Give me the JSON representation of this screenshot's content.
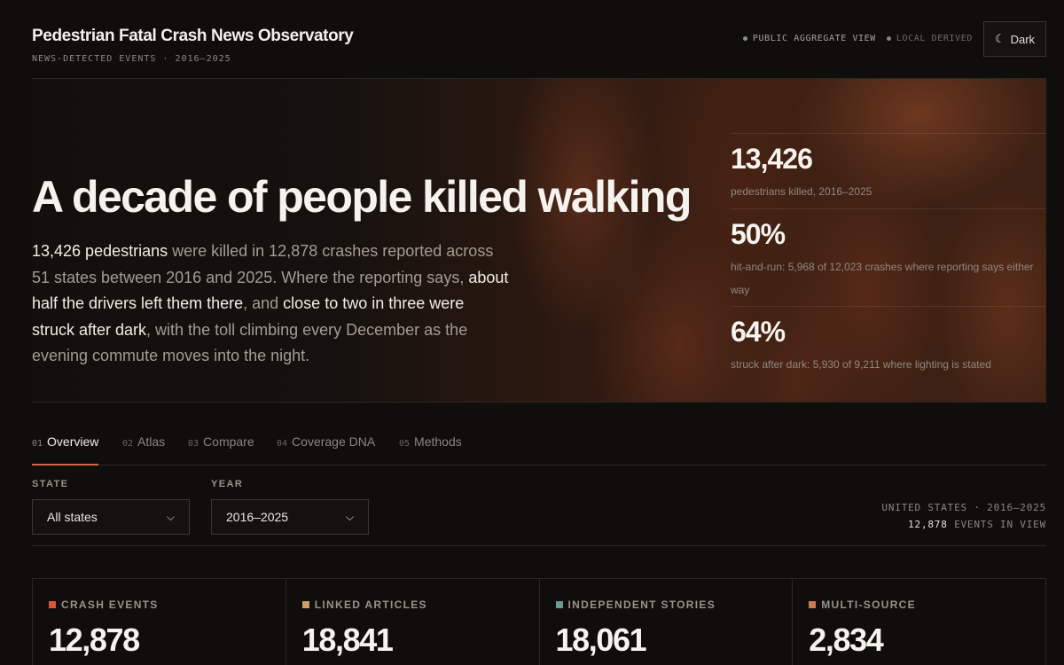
{
  "header": {
    "title": "Pedestrian Fatal Crash News Observatory",
    "subtitle": "NEWS-DETECTED EVENTS · 2016–2025",
    "status_public": "PUBLIC AGGREGATE VIEW",
    "status_local": "LOCAL DERIVED",
    "theme_icon": "☾",
    "theme_label": "Dark"
  },
  "hero": {
    "title": "A decade of people killed walking",
    "body": {
      "p1_hl": "13,426 pedestrians",
      "p2": " were killed in 12,878 crashes reported across 51 states between 2016 and 2025. Where the reporting says, ",
      "p3_hl": "about half the drivers left them there",
      "p4": ", and ",
      "p5_hl": "close to two in three were struck after dark",
      "p6": ", with the toll climbing every December as the evening commute moves into the night."
    },
    "stats": [
      {
        "value": "13,426",
        "label": "pedestrians killed, 2016–2025"
      },
      {
        "value": "50%",
        "label": "hit-and-run: 5,968 of 12,023 crashes where reporting says either way"
      },
      {
        "value": "64%",
        "label": "struck after dark: 5,930 of 9,211 where lighting is stated"
      }
    ]
  },
  "tabs": [
    {
      "num": "01",
      "label": "Overview",
      "active": true
    },
    {
      "num": "02",
      "label": "Atlas"
    },
    {
      "num": "03",
      "label": "Compare"
    },
    {
      "num": "04",
      "label": "Coverage DNA"
    },
    {
      "num": "05",
      "label": "Methods"
    }
  ],
  "filters": {
    "state_label": "STATE",
    "state_value": "All states",
    "year_label": "YEAR",
    "year_value": "2016–2025",
    "view_scope": "UNITED STATES · 2016–2025",
    "view_count": "12,878",
    "view_suffix": " EVENTS IN VIEW"
  },
  "kpis": [
    {
      "label": "CRASH EVENTS",
      "value": "12,878",
      "color": "#d9543a"
    },
    {
      "label": "LINKED ARTICLES",
      "value": "18,841",
      "color": "#c9a064"
    },
    {
      "label": "INDEPENDENT STORIES",
      "value": "18,061",
      "color": "#6e9a92"
    },
    {
      "label": "MULTI-SOURCE",
      "value": "2,834",
      "color": "#d07a4a"
    }
  ]
}
